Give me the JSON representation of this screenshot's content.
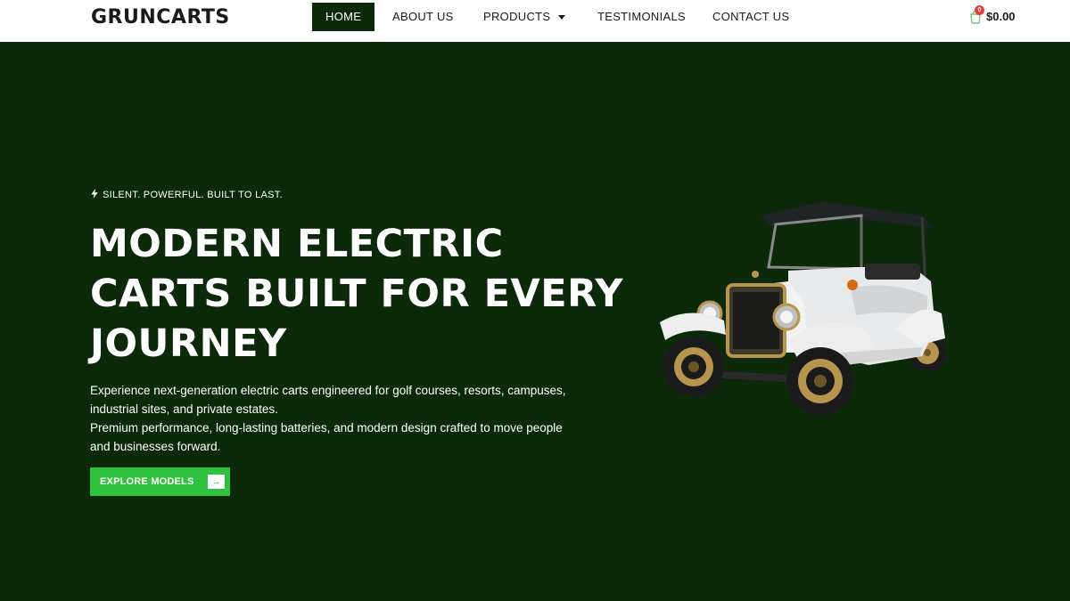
{
  "brand": {
    "logo": "GRUNCARTS"
  },
  "nav": {
    "items": [
      {
        "label": "HOME",
        "active": true
      },
      {
        "label": "ABOUT US"
      },
      {
        "label": "PRODUCTS",
        "has_dropdown": true
      },
      {
        "label": "TESTIMONIALS"
      },
      {
        "label": "CONTACT US"
      }
    ]
  },
  "cart": {
    "count": "0",
    "total": "$0.00",
    "icon": "shopping-bag-icon"
  },
  "hero": {
    "tagline": "SILENT. POWERFUL. BUILT TO LAST.",
    "tagline_icon": "bolt-icon",
    "headline_lines": [
      "MODERN ELECTRIC",
      "CARTS BUILT FOR EVERY",
      "JOURNEY"
    ],
    "description": [
      "Experience next-generation electric carts engineered for golf courses, resorts, campuses, industrial sites, and private estates.",
      "Premium performance, long-lasting batteries, and modern design crafted to move people and businesses forward."
    ],
    "cta_label": "EXPLORE MODELS",
    "cta_icon": "arrow-right-icon",
    "image_subject": "vintage-electric-cart-image"
  },
  "colors": {
    "dark_green": "#0c2a0a",
    "accent_green": "#2fc23f",
    "white": "#ffffff",
    "badge_red": "#e04040"
  }
}
